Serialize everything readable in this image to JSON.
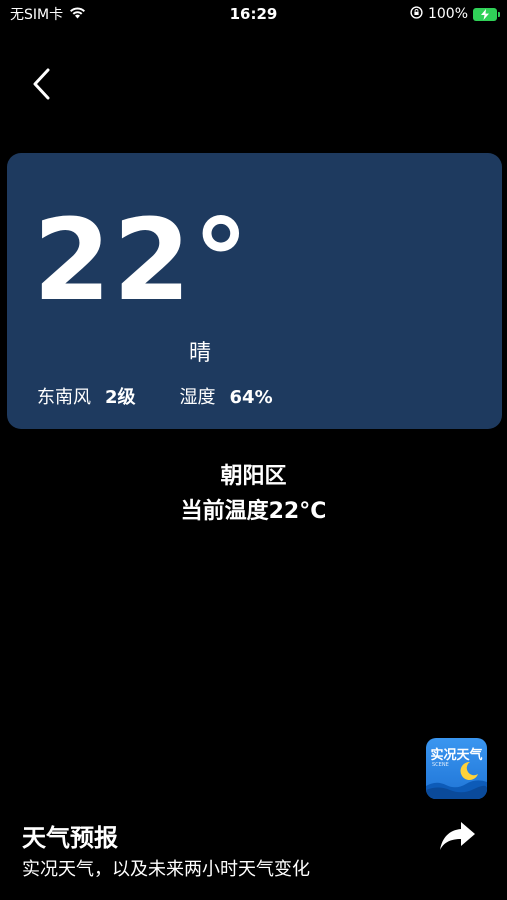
{
  "status_bar": {
    "carrier": "无SIM卡",
    "time": "16:29",
    "battery": "100%"
  },
  "icons": {
    "back": "chevron-left-icon",
    "wifi": "wifi-icon",
    "lock": "rotation-lock-icon",
    "battery": "battery-charging-icon",
    "share": "share-arrow-icon"
  },
  "weather": {
    "temperature": "22°",
    "condition": "晴",
    "wind_label": "东南风",
    "wind_value": "2级",
    "humidity_label": "湿度",
    "humidity_value": "64%"
  },
  "location": {
    "district": "朝阳区",
    "current_temp": "当前温度22°C"
  },
  "app_icon": {
    "title": "实况天气",
    "subtitle": "SCENE"
  },
  "footer": {
    "title": "天气预报",
    "subtitle": "实况天气，以及未来两小时天气变化"
  },
  "colors": {
    "background": "#000000",
    "card": "#1e3a5f",
    "battery": "#30d158",
    "app_icon": "#2e86e8"
  }
}
